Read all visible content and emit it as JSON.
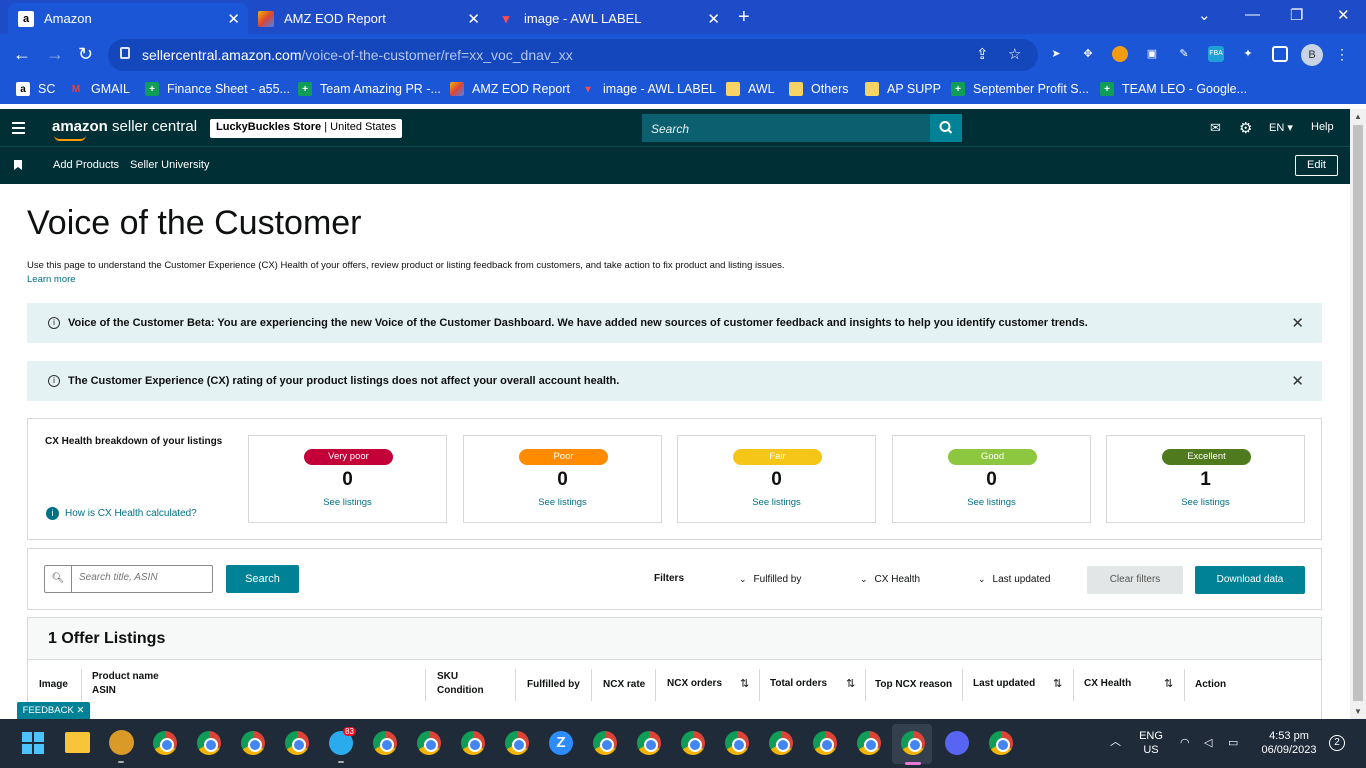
{
  "browser": {
    "tabs": [
      {
        "title": "Amazon",
        "icon": "amazon-favicon"
      },
      {
        "title": "AMZ EOD Report",
        "icon": "report-favicon"
      },
      {
        "title": "image - AWL LABEL",
        "icon": "awl-favicon"
      }
    ],
    "url_host": "sellercentral.amazon.com",
    "url_path": "/voice-of-the-customer/ref=xx_voc_dnav_xx",
    "profile_initial": "B",
    "bookmarks": [
      "SC",
      "GMAIL",
      "Finance Sheet - a55...",
      "Team Amazing PR -...",
      "AMZ EOD Report",
      "image - AWL LABEL",
      "AWL",
      "Others",
      "AP SUPP",
      "September Profit S...",
      "TEAM LEO - Google..."
    ]
  },
  "header": {
    "logo_a": "amazon",
    "logo_b": "seller central",
    "store": "LuckyBuckles Store",
    "marketplace": "United States",
    "search_placeholder": "Search",
    "language": "EN",
    "help": "Help"
  },
  "subnav": {
    "links": [
      "Add Products",
      "Seller University"
    ],
    "edit": "Edit"
  },
  "page": {
    "title": "Voice of the Customer",
    "description": "Use this page to understand the Customer Experience (CX) Health of your offers, review product or listing feedback from customers, and take action to fix product and listing issues.",
    "learn_more": "Learn more",
    "alert1": "Voice of the Customer Beta: You are experiencing the new Voice of the Customer Dashboard. We have added new sources of customer feedback and insights to help you identify customer trends.",
    "alert2": "The Customer Experience (CX) rating of your product listings does not affect your overall account health."
  },
  "cx": {
    "title": "CX Health breakdown of your listings",
    "help_link": "How is CX Health calculated?",
    "cards": [
      {
        "label": "Very poor",
        "count": "0",
        "link": "See listings",
        "color": "#c40039"
      },
      {
        "label": "Poor",
        "count": "0",
        "link": "See listings",
        "color": "#ff8c00"
      },
      {
        "label": "Fair",
        "count": "0",
        "link": "See listings",
        "color": "#f5c518"
      },
      {
        "label": "Good",
        "count": "0",
        "link": "See listings",
        "color": "#8dc63f"
      },
      {
        "label": "Excellent",
        "count": "1",
        "link": "See listings",
        "color": "#507a1e"
      }
    ]
  },
  "filters": {
    "search_placeholder": "Search title, ASIN",
    "search_button": "Search",
    "label": "Filters",
    "dropdowns": [
      "Fulfilled by",
      "CX Health",
      "Last updated"
    ],
    "clear": "Clear filters",
    "download": "Download data"
  },
  "listings": {
    "heading": "1 Offer Listings",
    "columns": {
      "image": "Image",
      "product_name": "Product name",
      "asin": "ASIN",
      "sku": "SKU",
      "condition": "Condition",
      "fulfilled_by": "Fulfilled by",
      "ncx_rate": "NCX rate",
      "ncx_orders": "NCX orders",
      "total_orders": "Total orders",
      "top_ncx_reason": "Top NCX reason",
      "last_updated": "Last updated",
      "cx_health": "CX Health",
      "action": "Action"
    }
  },
  "feedback": "FEEDBACK ✕",
  "taskbar": {
    "lang1": "ENG",
    "lang2": "US",
    "time": "4:53 pm",
    "date": "06/09/2023",
    "notifications": "2",
    "telegram_badge": "83"
  }
}
